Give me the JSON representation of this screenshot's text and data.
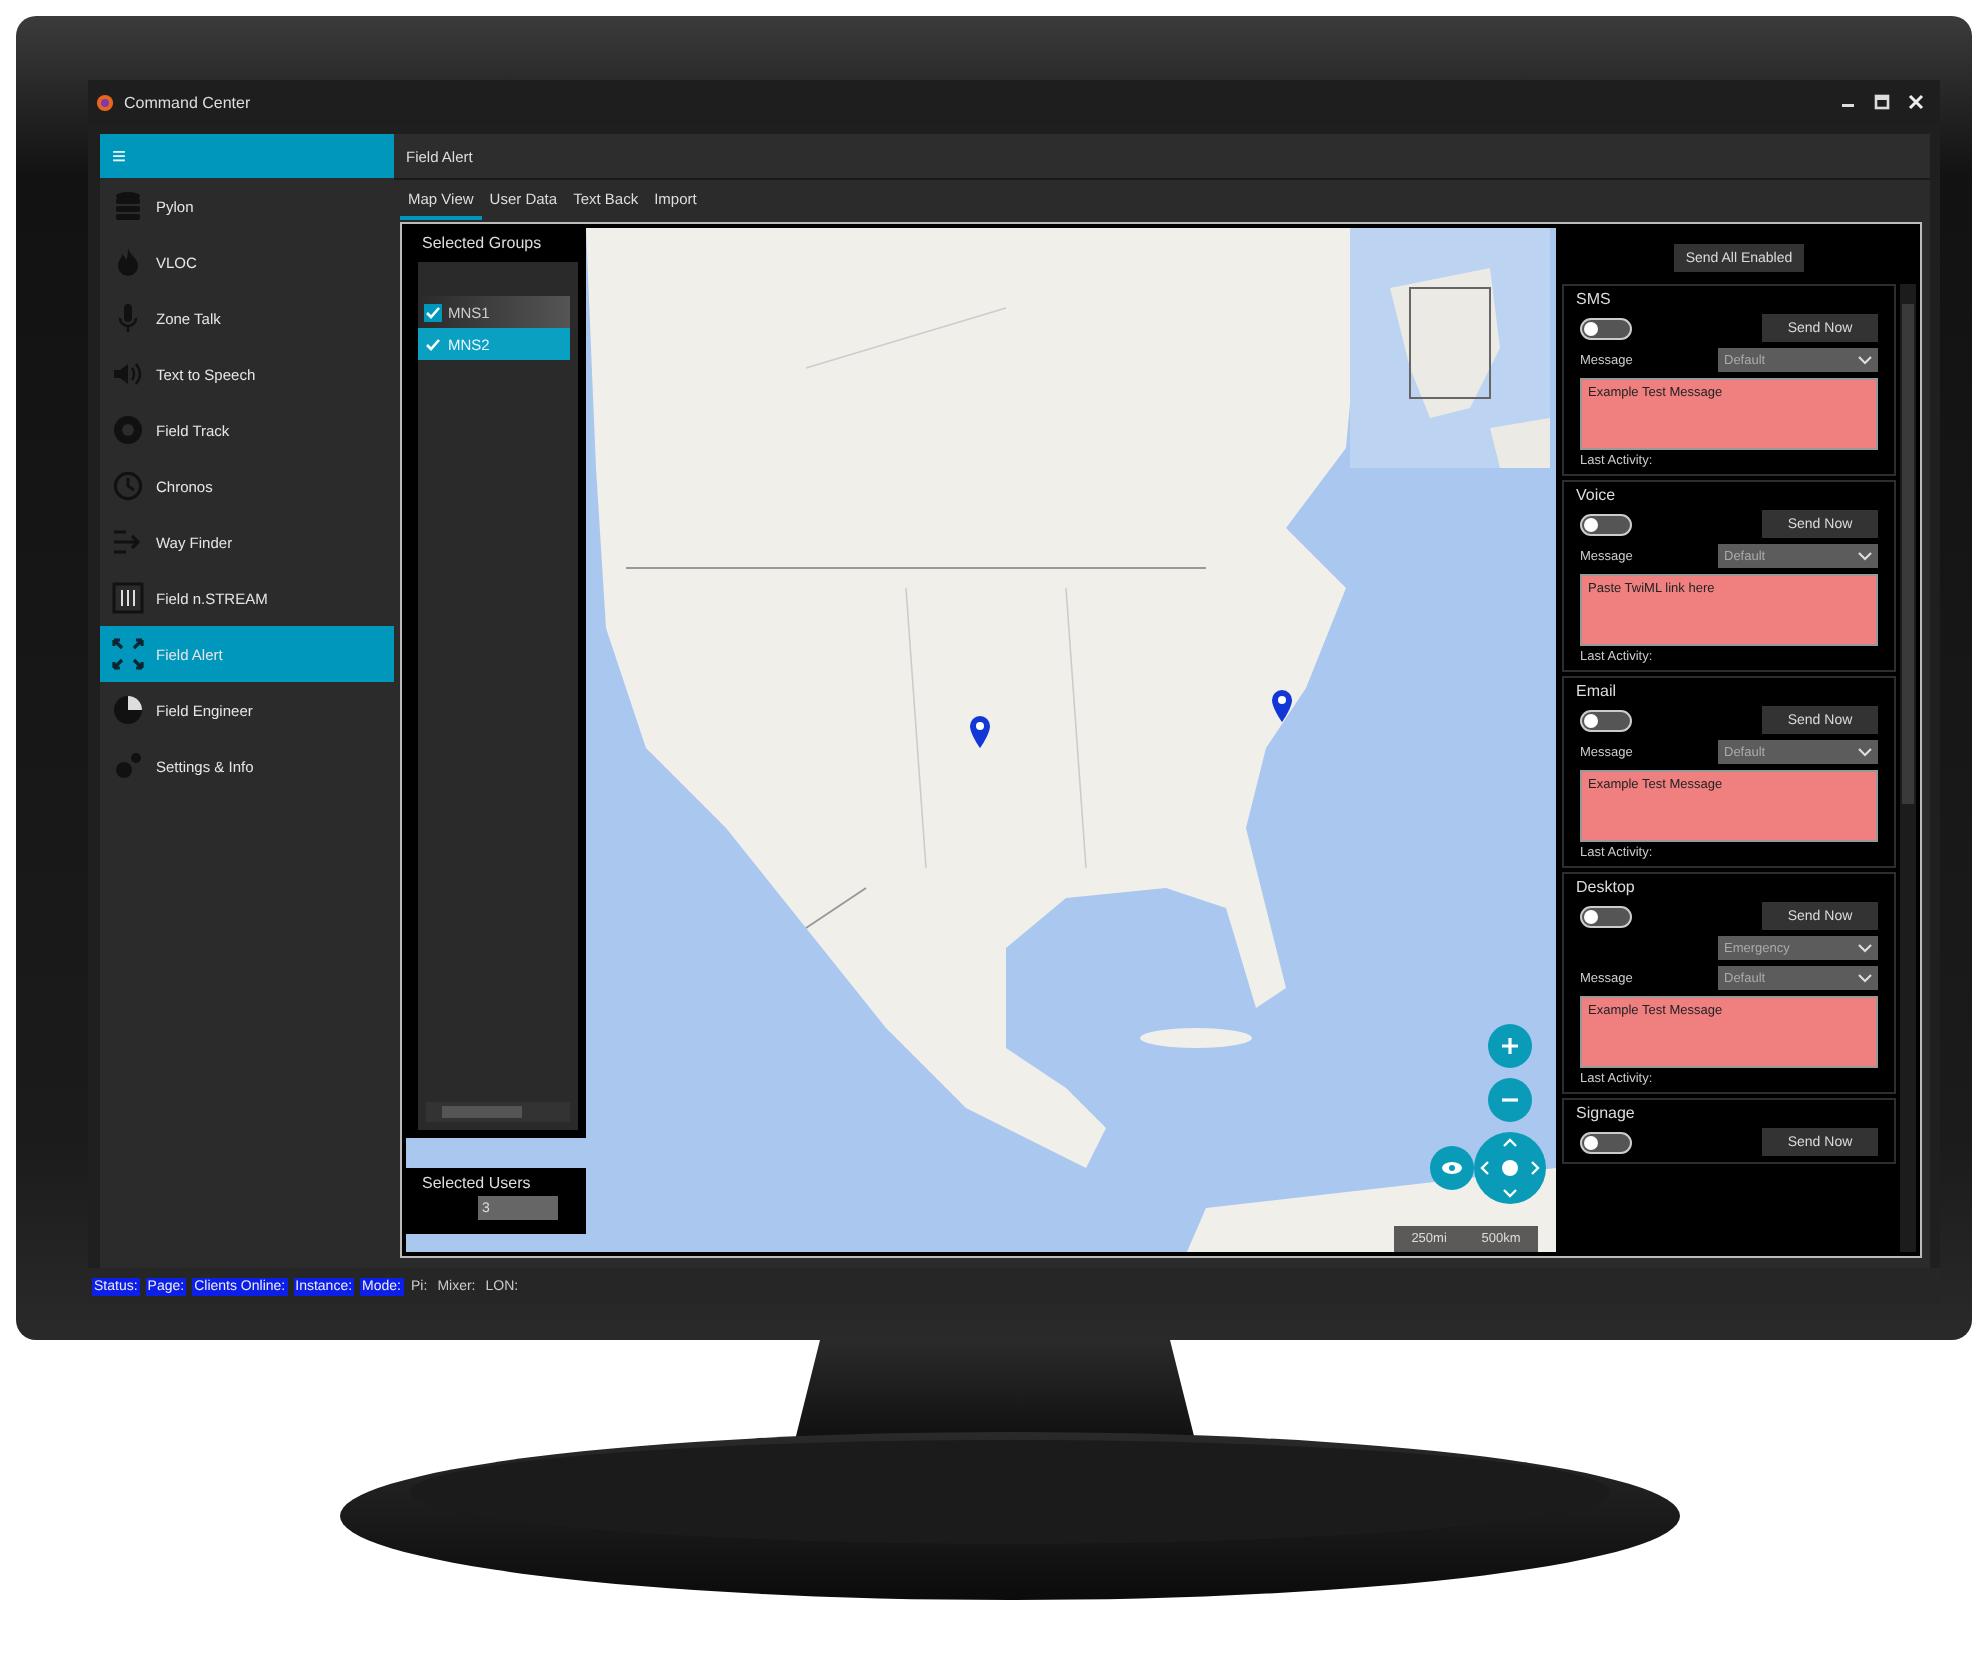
{
  "window": {
    "title": "Command Center"
  },
  "sidebar": {
    "menu_glyph": "≡",
    "items": [
      {
        "label": "Pylon",
        "selected": false
      },
      {
        "label": "VLOC",
        "selected": false
      },
      {
        "label": "Zone Talk",
        "selected": false
      },
      {
        "label": "Text to Speech",
        "selected": false
      },
      {
        "label": "Field Track",
        "selected": false
      },
      {
        "label": "Chronos",
        "selected": false
      },
      {
        "label": "Way Finder",
        "selected": false
      },
      {
        "label": "Field n.STREAM",
        "selected": false
      },
      {
        "label": "Field Alert",
        "selected": true
      },
      {
        "label": "Field Engineer",
        "selected": false
      },
      {
        "label": "Settings & Info",
        "selected": false
      }
    ]
  },
  "page": {
    "title": "Field Alert"
  },
  "tabs": [
    {
      "label": "Map View",
      "selected": true
    },
    {
      "label": "User Data",
      "selected": false
    },
    {
      "label": "Text Back",
      "selected": false
    },
    {
      "label": "Import",
      "selected": false
    }
  ],
  "map": {
    "groups_panel": {
      "title": "Selected Groups",
      "groups": [
        {
          "label": "MNS1",
          "checked": true,
          "selected": false
        },
        {
          "label": "MNS2",
          "checked": true,
          "selected": true
        }
      ]
    },
    "users_panel": {
      "label": "Selected Users",
      "value": "3"
    },
    "scale": [
      "250mi",
      "500km"
    ]
  },
  "alerts": {
    "send_all": "Send All Enabled",
    "channels": [
      {
        "name": "SMS",
        "on": false,
        "send_label": "Send Now",
        "message_label": "Message",
        "selects": [
          "Default"
        ],
        "message": "Example Test Message",
        "last_activity": "Last Activity:"
      },
      {
        "name": "Voice",
        "on": false,
        "send_label": "Send Now",
        "message_label": "Message",
        "selects": [
          "Default"
        ],
        "message": "Paste TwiML link here",
        "last_activity": "Last Activity:"
      },
      {
        "name": "Email",
        "on": false,
        "send_label": "Send Now",
        "message_label": "Message",
        "selects": [
          "Default"
        ],
        "message": "Example Test Message",
        "last_activity": "Last Activity:"
      },
      {
        "name": "Desktop",
        "on": false,
        "send_label": "Send Now",
        "message_label": "Message",
        "selects": [
          "Emergency",
          "Default"
        ],
        "message": "Example Test Message",
        "last_activity": "Last Activity:"
      },
      {
        "name": "Signage",
        "on": false,
        "send_label": "Send Now"
      }
    ]
  },
  "status_bar": [
    {
      "label": "Status:",
      "highlighted": true
    },
    {
      "label": "Page:",
      "highlighted": true
    },
    {
      "label": "Clients Online:",
      "highlighted": true
    },
    {
      "label": "Instance:",
      "highlighted": true
    },
    {
      "label": "Mode:",
      "highlighted": true
    },
    {
      "label": "Pi:",
      "highlighted": false
    },
    {
      "label": "Mixer:",
      "highlighted": false
    },
    {
      "label": "LON:",
      "highlighted": false
    }
  ]
}
